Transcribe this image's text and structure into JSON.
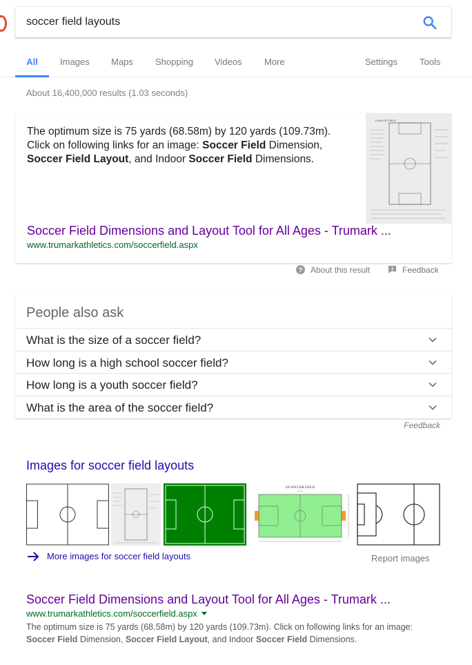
{
  "search": {
    "query": "soccer field layouts",
    "button_icon": "search-icon"
  },
  "tabs": {
    "all": "All",
    "images": "Images",
    "maps": "Maps",
    "shopping": "Shopping",
    "videos": "Videos",
    "more": "More",
    "settings": "Settings",
    "tools": "Tools"
  },
  "stats": "About 16,400,000 results (1.03 seconds)",
  "featured_snippet": {
    "line1": "The optimum size is 75 yards (68.58m) by 120 yards (109.73m).",
    "line2_a": "Click on following links for an image: ",
    "line2_b": "Soccer Field",
    "line2_c": " Dimension,",
    "line3_a": "Soccer Field Layout",
    "line3_b": ", and Indoor ",
    "line3_c": "Soccer Field",
    "line3_d": " Dimensions.",
    "link_title": "Soccer Field Dimensions and Layout Tool for All Ages - Trumark ...",
    "url": "www.trumarkathletics.com/soccerfield.aspx",
    "thumb_caption": "PLAN OF FIELD",
    "about": "About this result",
    "feedback": "Feedback"
  },
  "people_also_ask": {
    "title": "People also ask",
    "questions": [
      "What is the size of a soccer field?",
      "How long is a high school soccer field?",
      "How long is a youth soccer field?",
      "What is the area of the soccer field?"
    ],
    "feedback": "Feedback"
  },
  "images": {
    "heading": "Images for soccer field layouts",
    "more_label": "More images for soccer field layouts",
    "report_label": "Report images",
    "tile4_caption": "U8 SOCCER FIELD",
    "tile4_sub": "6 v 6"
  },
  "result": {
    "title": "Soccer Field Dimensions and Layout Tool for All Ages - Trumark ...",
    "url": "www.trumarkathletics.com/soccerfield.aspx",
    "snippet_a": "The optimum size is 75 yards (68.58m) by 120 yards (109.73m). Click on following links for an image:",
    "snippet_b": "Soccer Field",
    "snippet_c": " Dimension, ",
    "snippet_d": "Soccer Field Layout",
    "snippet_e": ", and Indoor ",
    "snippet_f": "Soccer Field",
    "snippet_g": " Dimensions."
  },
  "colors": {
    "link_blue": "#1a0dab",
    "visited_purple": "#660099",
    "url_green": "#006621",
    "tab_blue": "#4285f4",
    "field_green": "#008000",
    "field_light_green": "#90ee90"
  }
}
